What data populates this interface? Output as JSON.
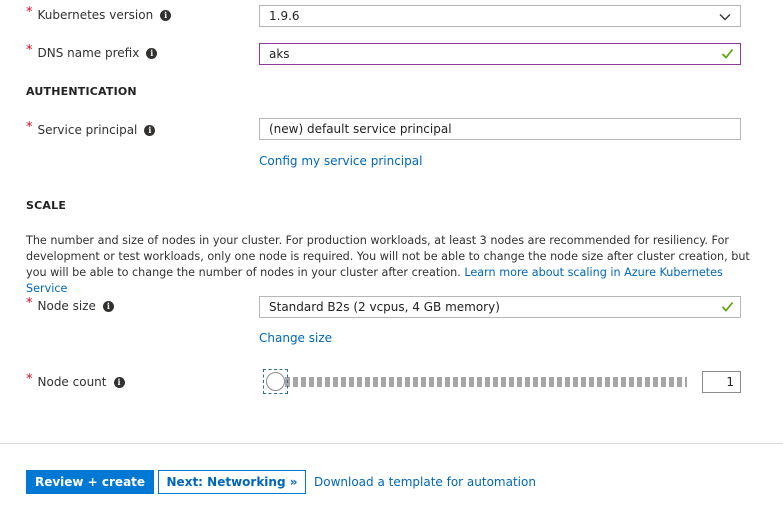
{
  "basics": {
    "kubernetes_version": {
      "label": "Kubernetes version",
      "value": "1.9.6"
    },
    "dns_prefix": {
      "label": "DNS name prefix",
      "value": "aks"
    }
  },
  "authentication": {
    "heading": "AUTHENTICATION",
    "service_principal": {
      "label": "Service principal",
      "value": "(new) default service principal"
    },
    "config_link": "Config my service principal"
  },
  "scale": {
    "heading": "SCALE",
    "description": "The number and size of nodes in your cluster. For production workloads, at least 3 nodes are recommended for resiliency. For development or test workloads, only one node is required. You will not be able to change the node size after cluster creation, but you will be able to change the number of nodes in your cluster after creation.",
    "learn_more_link": "Learn more about scaling in Azure Kubernetes Service",
    "node_size": {
      "label": "Node size",
      "value": "Standard B2s (2 vcpus, 4 GB memory)"
    },
    "change_size_link": "Change size",
    "node_count": {
      "label": "Node count",
      "value": "1"
    }
  },
  "footer": {
    "review_create": "Review + create",
    "next_networking": "Next: Networking »",
    "download_template": "Download a template for automation"
  },
  "colors": {
    "required": "#e00b1c",
    "link": "#0067b8",
    "primary": "#0078d4",
    "valid_check": "#57a300",
    "focus_border": "#8a3a9c"
  }
}
